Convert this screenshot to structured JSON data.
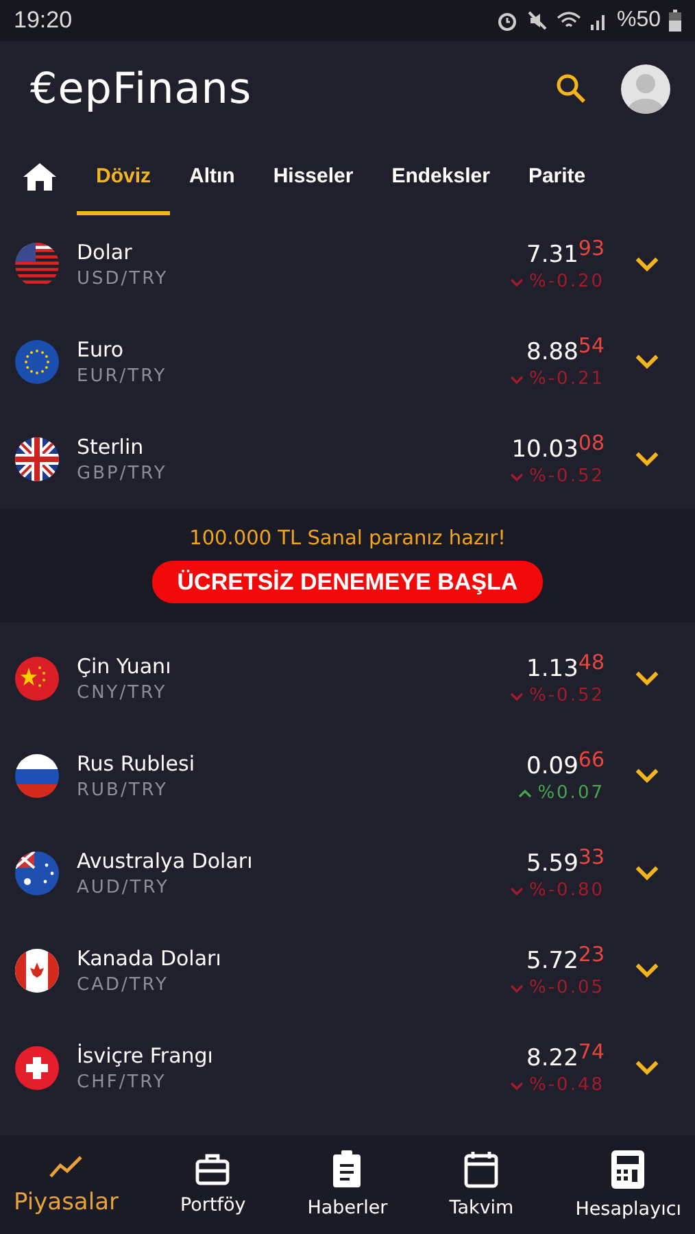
{
  "status_bar": {
    "time": "19:20",
    "battery": "%50"
  },
  "header": {
    "logo": "€epFinans"
  },
  "tabs": [
    {
      "label": "Döviz",
      "selected": true
    },
    {
      "label": "Altın",
      "selected": false
    },
    {
      "label": "Hisseler",
      "selected": false
    },
    {
      "label": "Endeksler",
      "selected": false
    },
    {
      "label": "Parite",
      "selected": false
    }
  ],
  "rows_top": [
    {
      "kind": "us",
      "name": "Dolar",
      "pair": "USD/TRY",
      "price": "7.31",
      "price_tail": "93",
      "rising": false,
      "change": "%-0.20"
    },
    {
      "kind": "eu",
      "name": "Euro",
      "pair": "EUR/TRY",
      "price": "8.88",
      "price_tail": "54",
      "rising": false,
      "change": "%-0.21"
    },
    {
      "kind": "gb",
      "name": "Sterlin",
      "pair": "GBP/TRY",
      "price": "10.03",
      "price_tail": "08",
      "rising": false,
      "change": "%-0.52"
    }
  ],
  "promo": {
    "text": "100.000 TL Sanal paranız hazır!",
    "button": "ÜCRETSİZ DENEMEYE BAŞLA"
  },
  "rows_bottom": [
    {
      "kind": "cn",
      "name": "Çin Yuanı",
      "pair": "CNY/TRY",
      "price": "1.13",
      "price_tail": "48",
      "rising": false,
      "change": "%-0.52"
    },
    {
      "kind": "ru",
      "name": "Rus Rublesi",
      "pair": "RUB/TRY",
      "price": "0.09",
      "price_tail": "66",
      "rising": true,
      "change": "%0.07"
    },
    {
      "kind": "au",
      "name": "Avustralya Doları",
      "pair": "AUD/TRY",
      "price": "5.59",
      "price_tail": "33",
      "rising": false,
      "change": "%-0.80"
    },
    {
      "kind": "ca",
      "name": "Kanada Doları",
      "pair": "CAD/TRY",
      "price": "5.72",
      "price_tail": "23",
      "rising": false,
      "change": "%-0.05"
    },
    {
      "kind": "ch",
      "name": "İsviçre Frangı",
      "pair": "CHF/TRY",
      "price": "8.22",
      "price_tail": "74",
      "rising": false,
      "change": "%-0.48"
    }
  ],
  "bottom_nav": [
    {
      "label": "Piyasalar",
      "kind": "trend",
      "selected": true
    },
    {
      "label": "Portföy",
      "kind": "briefcase",
      "selected": false
    },
    {
      "label": "Haberler",
      "kind": "clipboard",
      "selected": false
    },
    {
      "label": "Takvim",
      "kind": "calendar",
      "selected": false
    },
    {
      "label": "Hesaplayıcı",
      "kind": "calculator",
      "selected": false
    }
  ]
}
